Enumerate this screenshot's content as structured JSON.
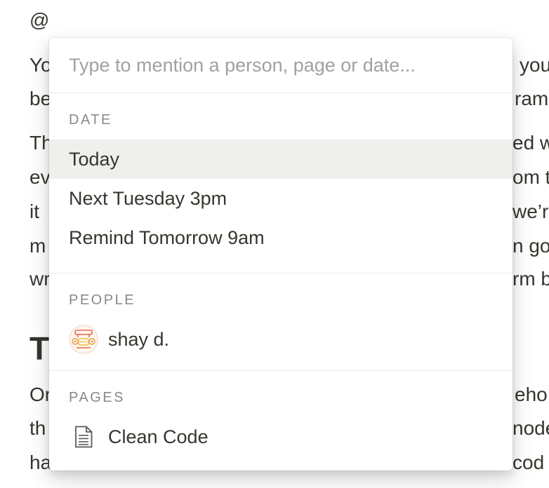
{
  "document": {
    "mention_char": "@",
    "left_fragments": [
      "Yo",
      "be",
      "Th",
      "ev",
      "it",
      "m",
      "wr"
    ],
    "right_fragments": [
      "you",
      "ram",
      "ed w",
      "om t",
      "we’r",
      "n go",
      "rm b"
    ],
    "heading_fragment": "T",
    "bottom_left_fragments": [
      "Or",
      "th",
      "ha"
    ],
    "bottom_right_fragments": [
      "eho",
      "node",
      "cod"
    ]
  },
  "popup": {
    "search": {
      "value": "",
      "placeholder": "Type to mention a person, page or date..."
    },
    "sections": {
      "date": {
        "header": "DATE",
        "items": [
          "Today",
          "Next Tuesday 3pm",
          "Remind Tomorrow 9am"
        ],
        "selected_index": 0
      },
      "people": {
        "header": "PEOPLE",
        "items": [
          {
            "label": "shay d.",
            "icon": "avatar-icon"
          }
        ]
      },
      "pages": {
        "header": "PAGES",
        "items": [
          {
            "label": "Clean Code",
            "icon": "page-icon"
          }
        ]
      }
    }
  },
  "colors": {
    "text": "#37352f",
    "muted": "#8a8985",
    "placeholder": "#a2a19e",
    "selected_bg": "#efefee",
    "divider": "#e9e9e7"
  }
}
